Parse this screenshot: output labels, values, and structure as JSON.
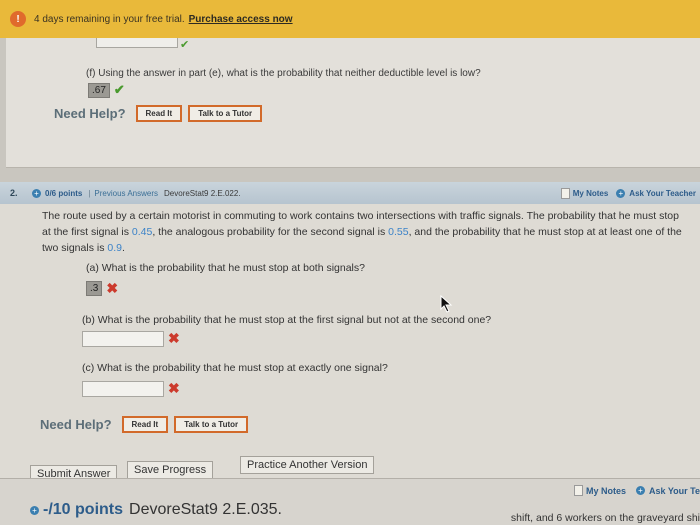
{
  "banner": {
    "warning_icon": "!",
    "text": "4 days remaining in your free trial.",
    "link": "Purchase access now"
  },
  "prev_question": {
    "part_f_text": "(f) Using the answer in part (e), what is the probability that neither deductible level is low?",
    "part_f_answer": ".67",
    "help_label": "Need Help?",
    "read_it": "Read It",
    "talk_tutor": "Talk to a Tutor"
  },
  "q2": {
    "number": "2.",
    "points": "0/6 points",
    "separator": "|",
    "previous_answers": "Previous Answers",
    "code": "DevoreStat9 2.E.022.",
    "my_notes": "My Notes",
    "ask_teacher": "Ask Your Teacher",
    "body_1": "The route used by a certain motorist in commuting to work contains two intersections with traffic signals. The probability that he must stop at the first signal is ",
    "p1": "0.45",
    "body_2": ", the analogous probability for the second signal is ",
    "p2": "0.55",
    "body_3": ", and the probability that he must stop at at least one of the two signals is ",
    "p3": "0.9",
    "body_4": ".",
    "part_a": "(a) What is the probability that he must stop at both signals?",
    "part_a_answer": ".3",
    "part_b": "(b) What is the probability that he must stop at the first signal but not at the second one?",
    "part_c": "(c) What is the probability that he must stop at exactly one signal?",
    "help_label": "Need Help?",
    "read_it": "Read It",
    "talk_tutor": "Talk to a Tutor",
    "submit": "Submit Answer",
    "save": "Save Progress",
    "practice": "Practice Another Version"
  },
  "q3": {
    "points": "-/10 points",
    "code": "DevoreStat9 2.E.035.",
    "my_notes": "My Notes",
    "ask_teacher": "Ask Your Te",
    "text_fragment": "shift, and 6 workers on the graveyard shi"
  },
  "colors": {
    "banner": "#e9b93a",
    "accent_orange": "#d26a2a",
    "link_blue": "#2d5c8a",
    "value_blue": "#3c83c8",
    "correct_green": "#4a9a2e",
    "wrong_red": "#cc3a2c"
  }
}
